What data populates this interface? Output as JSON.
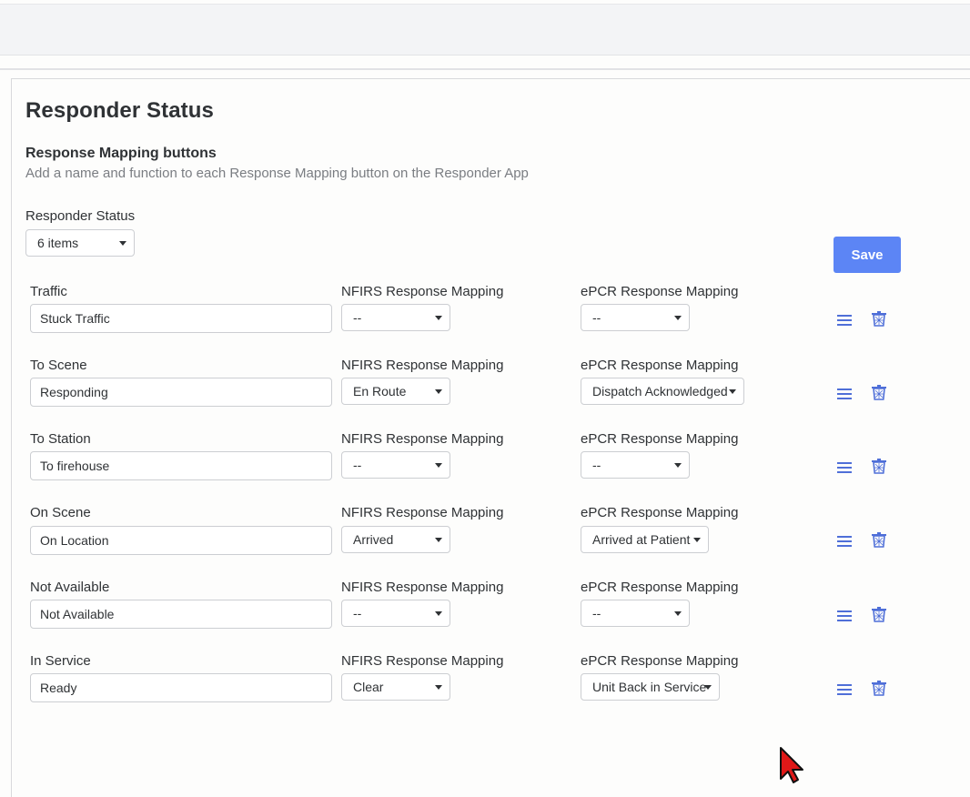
{
  "page": {
    "title": "Responder Status",
    "section_title": "Response Mapping buttons",
    "section_description": "Add a name and function to each Response Mapping button on the Responder App"
  },
  "responder_status": {
    "label": "Responder Status",
    "selected": "6 items"
  },
  "save_label": "Save",
  "colors": {
    "accent": "#5c85f5",
    "icon": "#4f6fd8"
  },
  "rows": [
    {
      "label": "Traffic",
      "value": "Stuck Traffic",
      "nfirs_label": "NFIRS Response Mapping",
      "nfirs_value": "--",
      "epcr_label": "ePCR Response Mapping",
      "epcr_value": "--"
    },
    {
      "label": "To Scene",
      "value": "Responding",
      "nfirs_label": "NFIRS Response Mapping",
      "nfirs_value": "En Route",
      "epcr_label": "ePCR Response Mapping",
      "epcr_value": "Dispatch Acknowledged"
    },
    {
      "label": "To Station",
      "value": "To firehouse",
      "nfirs_label": "NFIRS Response Mapping",
      "nfirs_value": "--",
      "epcr_label": "ePCR Response Mapping",
      "epcr_value": "--"
    },
    {
      "label": "On Scene",
      "value": "On Location",
      "nfirs_label": "NFIRS Response Mapping",
      "nfirs_value": "Arrived",
      "epcr_label": "ePCR Response Mapping",
      "epcr_value": "Arrived at Patient"
    },
    {
      "label": "Not Available",
      "value": "Not Available",
      "nfirs_label": "NFIRS Response Mapping",
      "nfirs_value": "--",
      "epcr_label": "ePCR Response Mapping",
      "epcr_value": "--"
    },
    {
      "label": "In Service",
      "value": "Ready",
      "nfirs_label": "NFIRS Response Mapping",
      "nfirs_value": "Clear",
      "epcr_label": "ePCR Response Mapping",
      "epcr_value": "Unit Back in Service"
    }
  ],
  "icons": {
    "reorder": "hamburger-menu-icon",
    "delete": "trash-can-icon",
    "pointer": "mouse-cursor-icon"
  }
}
